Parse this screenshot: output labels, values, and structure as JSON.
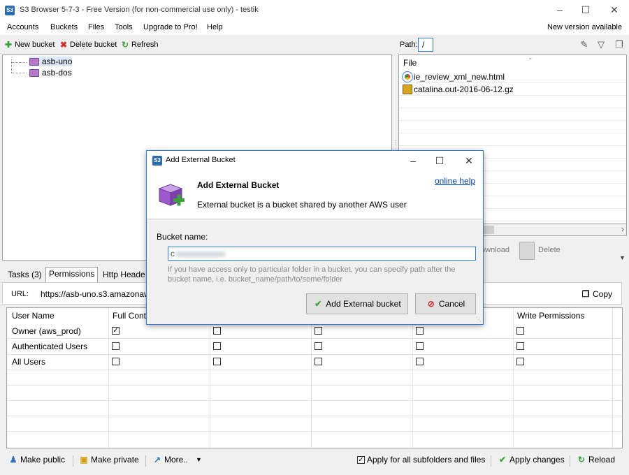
{
  "window": {
    "title": "S3 Browser 5-7-3 - Free Version (for non-commercial use only) - testik",
    "app_icon_text": "S3"
  },
  "menu": {
    "items": [
      "Accounts",
      "Buckets",
      "Files",
      "Tools",
      "Upgrade to Pro!",
      "Help"
    ],
    "new_version": "New version available"
  },
  "toolbar": {
    "new_bucket": "New bucket",
    "delete_bucket": "Delete bucket",
    "refresh": "Refresh"
  },
  "buckets": [
    {
      "name": "asb-uno"
    },
    {
      "name": "asb-dos"
    }
  ],
  "path": {
    "label": "Path:",
    "value": "/"
  },
  "files": {
    "header": "File",
    "items": [
      {
        "name": "ie_review_xml_new.html",
        "icon": "chrome-html-icon"
      },
      {
        "name": "catalina.out-2016-06-12.gz",
        "icon": "archive-icon"
      }
    ],
    "download_label": "ownload",
    "delete_label": "Delete"
  },
  "tabs": [
    {
      "label": "Tasks (3)"
    },
    {
      "label": "Permissions"
    },
    {
      "label": "Http Heade"
    }
  ],
  "url": {
    "label": "URL:",
    "value": "https://asb-uno.s3.amazonaw",
    "copy": "Copy"
  },
  "permissions": {
    "headers": [
      "User Name",
      "Full Contr",
      "",
      "",
      "",
      "Write Permissions"
    ],
    "rows": [
      {
        "user": "Owner (aws_prod)",
        "checks": [
          true,
          false,
          false,
          false,
          false
        ]
      },
      {
        "user": "Authenticated Users",
        "checks": [
          false,
          false,
          false,
          false,
          false
        ]
      },
      {
        "user": "All Users",
        "checks": [
          false,
          false,
          false,
          false,
          false
        ]
      }
    ]
  },
  "bottom": {
    "make_public": "Make public",
    "make_private": "Make private",
    "more": "More..",
    "apply_subfolders": "Apply for all subfolders and files",
    "apply_subfolders_checked": true,
    "apply_changes": "Apply changes",
    "reload": "Reload"
  },
  "dialog": {
    "title": "Add External Bucket",
    "heading": "Add External Bucket",
    "description": "External bucket is a bucket shared by another  AWS user",
    "help_link": "online help",
    "field_label": "Bucket name:",
    "field_value": "c",
    "hint": "If you have access only to particular folder in a bucket, you can specify path after the bucket name, i.e. bucket_name/path/to/some/folder",
    "add_button": "Add External bucket",
    "cancel_button": "Cancel"
  }
}
